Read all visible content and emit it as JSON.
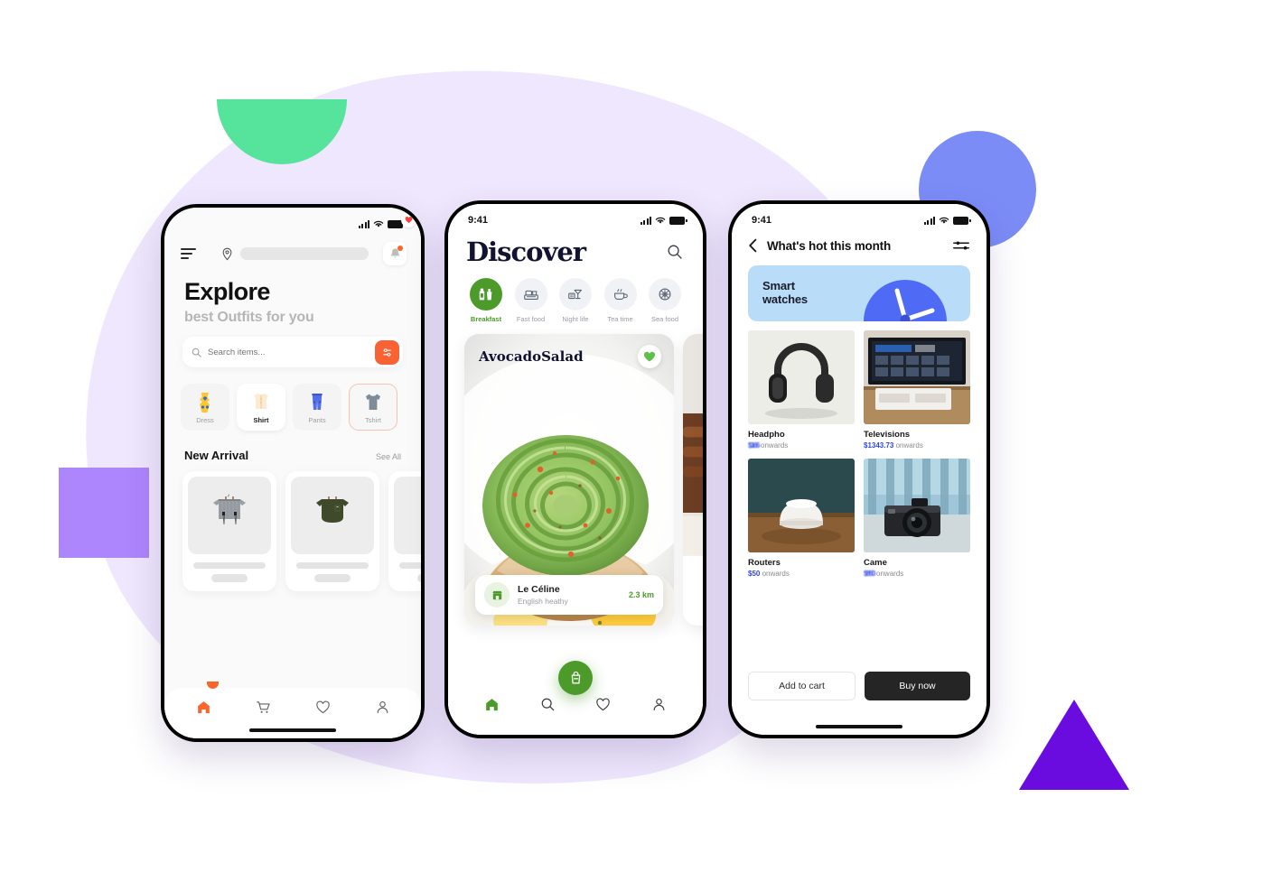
{
  "phone1": {
    "status": {
      "time": "",
      "icons": [
        "signal-icon",
        "wifi-icon",
        "battery-icon"
      ]
    },
    "header": {
      "menu_icon": "hamburger-icon",
      "location_icon": "location-pin-icon",
      "location_value": "",
      "bell_icon": "bell-icon"
    },
    "title": "Explore",
    "subtitle": "best Outfits for you",
    "search": {
      "placeholder": "Search items...",
      "value": "",
      "filter_icon": "filter-icon"
    },
    "chips": [
      {
        "label": "Dress",
        "icon": "dress-icon",
        "state": "idle"
      },
      {
        "label": "Shirt",
        "icon": "shirt-icon",
        "state": "active-white"
      },
      {
        "label": "Pants",
        "icon": "pants-icon",
        "state": "idle"
      },
      {
        "label": "Tshirt",
        "icon": "tshirt-icon",
        "state": "active-outline"
      }
    ],
    "section": {
      "title": "New Arrival",
      "link": "See All"
    },
    "tabs": [
      {
        "name": "home",
        "icon": "home-icon",
        "active": true
      },
      {
        "name": "cart",
        "icon": "cart-icon",
        "active": false
      },
      {
        "name": "wishlist",
        "icon": "heart-icon",
        "active": false
      },
      {
        "name": "profile",
        "icon": "person-icon",
        "active": false
      }
    ],
    "accent": "#F9652B"
  },
  "phone2": {
    "status": {
      "time": "9:41"
    },
    "title": "Discover",
    "search_icon": "search-icon",
    "categories": [
      {
        "label": "Breakfast",
        "icon": "breakfast-icon",
        "selected": true
      },
      {
        "label": "Fast food",
        "icon": "fastfood-icon",
        "selected": false
      },
      {
        "label": "Night life",
        "icon": "nightlife-icon",
        "selected": false
      },
      {
        "label": "Tea time",
        "icon": "teatime-icon",
        "selected": false
      },
      {
        "label": "Sea food",
        "icon": "seafood-icon",
        "selected": false
      }
    ],
    "food_card": {
      "name": "AvocadoSalad",
      "heart_icon": "heart-icon",
      "restaurant": {
        "name": "Le Céline",
        "cuisine": "English heathy",
        "distance": "2.3 km",
        "icon": "store-icon"
      }
    },
    "fab_icon": "order-bag-icon",
    "tabs": [
      {
        "name": "home",
        "icon": "home-icon",
        "active": true
      },
      {
        "name": "search",
        "icon": "search-icon",
        "active": false
      },
      {
        "name": "wishlist",
        "icon": "heart-icon",
        "active": false
      },
      {
        "name": "profile",
        "icon": "person-icon",
        "active": false
      }
    ],
    "accent": "#4C9A2A"
  },
  "phone3": {
    "status": {
      "time": "9:41"
    },
    "back_icon": "chevron-left-icon",
    "title": "What's hot this month",
    "filter_icon": "sliders-icon",
    "banner": {
      "text": "Smart\nwatches",
      "icon": "clock-icon",
      "bg": "#B9DDF8",
      "arc": "#4F6BF6"
    },
    "products": [
      {
        "name": "Headpho",
        "price": "$166",
        "price_suffix": "onwards",
        "blurred": true,
        "image": "headphones-photo"
      },
      {
        "name": "Televisions",
        "price": "$1343.73",
        "price_suffix": "onwards",
        "blurred": false,
        "image": "television-photo"
      },
      {
        "name": "Routers",
        "price": "$50",
        "price_suffix": "onwards",
        "blurred": false,
        "image": "router-photo"
      },
      {
        "name": "Came",
        "price": "$850",
        "price_suffix": "onwards",
        "blurred": true,
        "image": "camera-photo"
      }
    ],
    "actions": {
      "secondary": "Add to cart",
      "primary": "Buy now"
    },
    "accent": "#2F47E3"
  },
  "background": {
    "shapes": [
      {
        "name": "purple-blob",
        "color": "#EFE7FD"
      },
      {
        "name": "green-semicircle",
        "color": "#56E39B"
      },
      {
        "name": "blue-circle",
        "color": "#7B8CF7"
      },
      {
        "name": "purple-square",
        "color": "#AD85FC"
      },
      {
        "name": "violet-triangle",
        "color": "#6A0BE0"
      }
    ]
  }
}
